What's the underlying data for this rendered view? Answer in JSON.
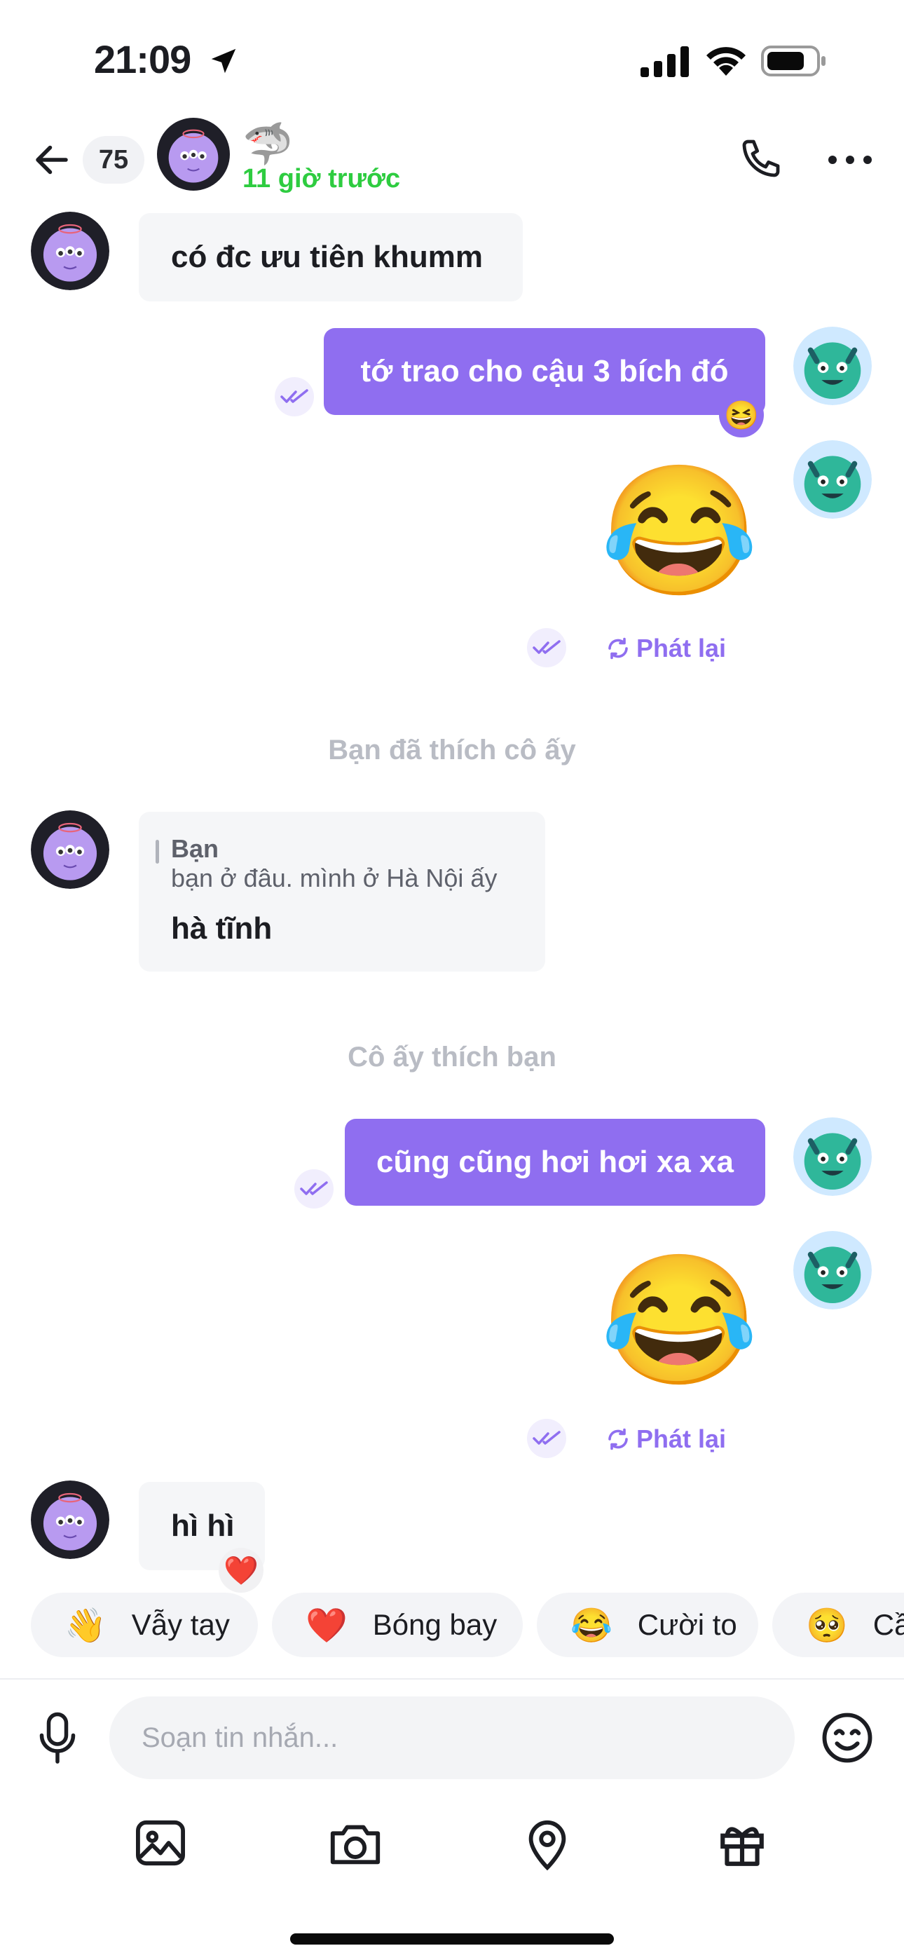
{
  "status_bar": {
    "time": "21:09"
  },
  "header": {
    "unread_count": "75",
    "status_emoji": "🦈",
    "last_seen": "11 giờ trước"
  },
  "messages": {
    "m1_text": "có đc ưu tiên khumm",
    "m2_text": "tớ trao cho cậu 3 bích đó",
    "m2_reaction": "😆",
    "m3_emoji": "😂",
    "m3_replay": "Phát lại",
    "system1": "Bạn đã thích cô ấy",
    "m4_quote_author": "Bạn",
    "m4_quote_text": "bạn ở đâu. mình ở Hà Nội ấy",
    "m4_text": "hà tĩnh",
    "system2": "Cô ấy thích bạn",
    "m5_text": "cũng cũng hơi hơi xa xa",
    "m6_emoji": "😂",
    "m6_replay": "Phát lại",
    "m7_text": "hì hì",
    "m7_reaction": "❤️"
  },
  "quick_replies": [
    {
      "emoji": "👋",
      "label": "Vẫy tay"
    },
    {
      "emoji": "❤️",
      "label": "Bóng bay"
    },
    {
      "emoji": "😂",
      "label": "Cười to"
    },
    {
      "emoji": "🥺",
      "label": "Cầ"
    }
  ],
  "composer": {
    "placeholder": "Soạn tin nhắn..."
  },
  "colors": {
    "accent": "#8f6ef0",
    "online": "#2ecc40",
    "bubble_in": "#f5f6f8"
  }
}
